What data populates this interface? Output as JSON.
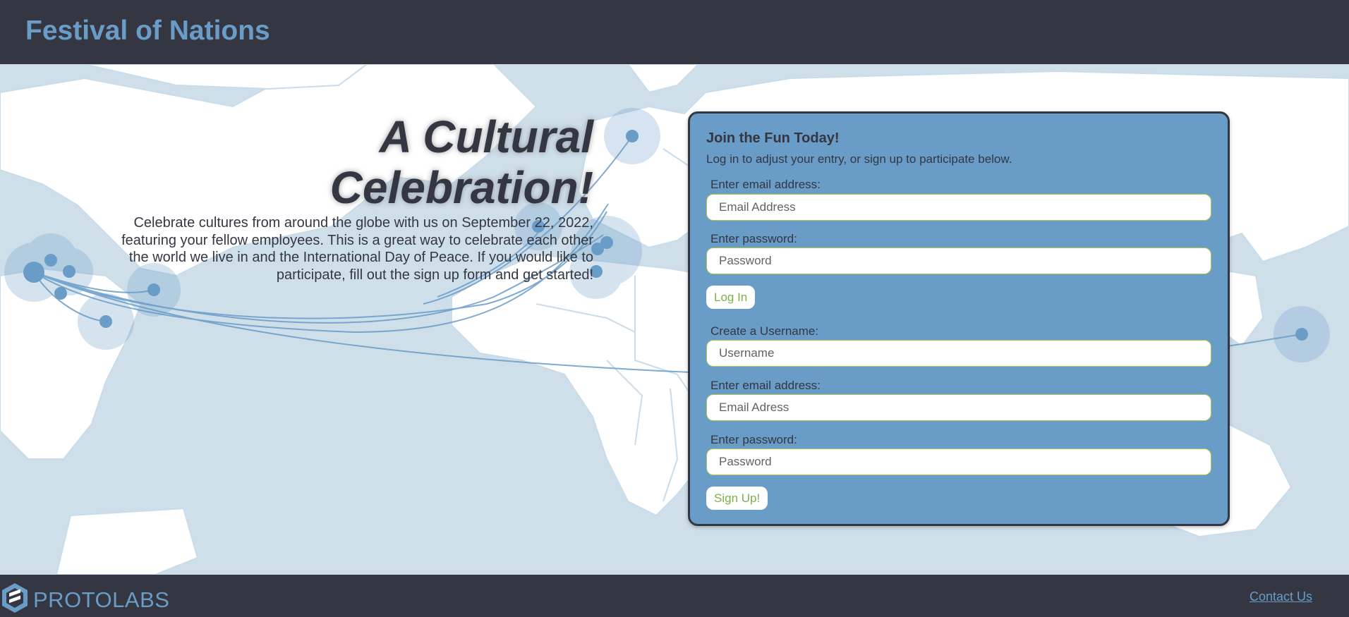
{
  "header": {
    "title": "Festival of Nations"
  },
  "hero": {
    "title": "A Cultural Celebration!",
    "description": "Celebrate cultures from around the globe with us on September 22, 2022, featuring your fellow employees. This is a great way to celebrate each other the world we live in and the International Day of Peace. If you would like to participate, fill out the sign up form and get started!"
  },
  "panel": {
    "title": "Join the Fun Today!",
    "subtitle": "Log in to adjust your entry, or sign up to participate below.",
    "login": {
      "email_label": "Enter email address:",
      "email_placeholder": "Email Address",
      "password_label": "Enter password:",
      "password_placeholder": "Password",
      "button": "Log In"
    },
    "signup": {
      "username_label": "Create a Username:",
      "username_placeholder": "Username",
      "email_label": "Enter email address:",
      "email_placeholder": "Email Adress",
      "password_label": "Enter password:",
      "password_placeholder": "Password",
      "button": "Sign Up!"
    }
  },
  "footer": {
    "logo_text": "PROTOLABS",
    "contact_link": "Contact Us"
  },
  "icons": [
    "world-map-background",
    "protolabs-logo-icon"
  ],
  "colors": {
    "dark": "#343741",
    "accent_blue": "#699cc6",
    "map_water": "#cfdfea",
    "button_text_green": "#7eb04a"
  }
}
